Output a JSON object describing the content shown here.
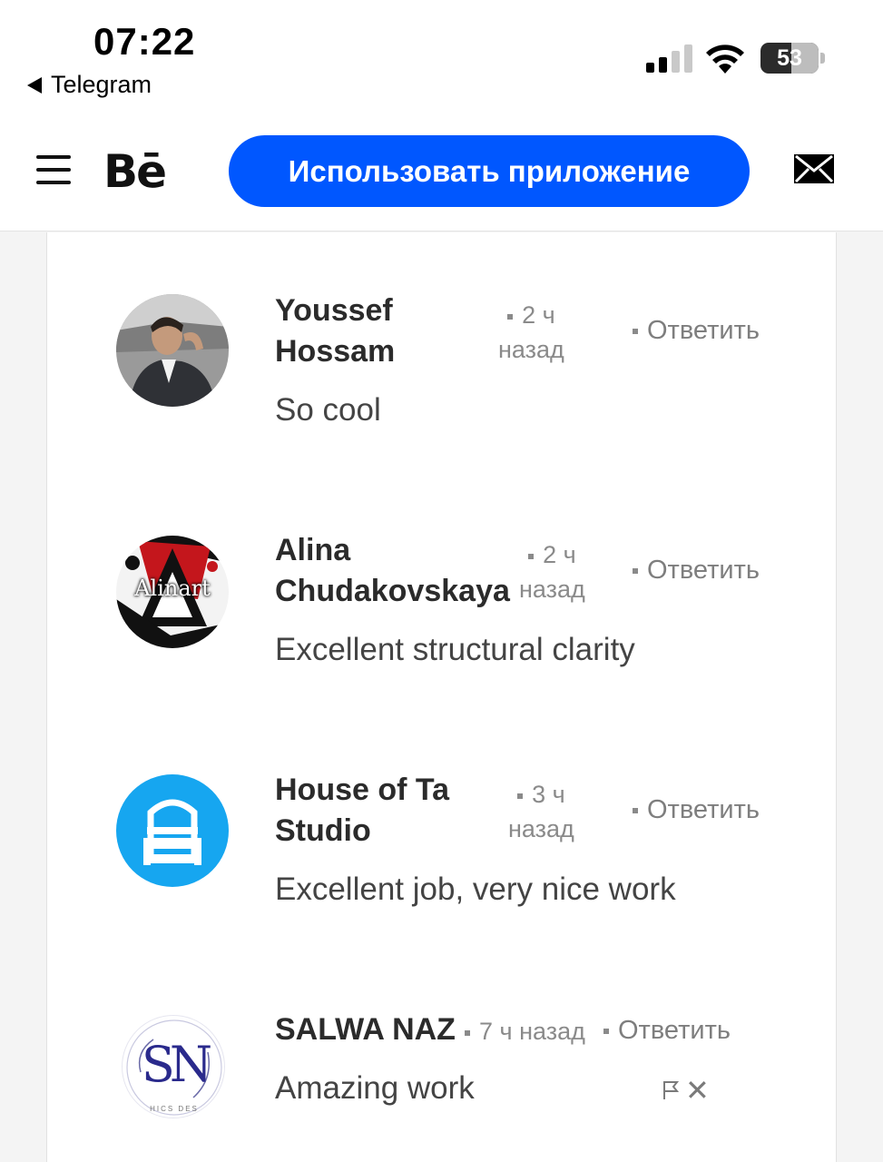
{
  "status_bar": {
    "time": "07:22",
    "back_label": "Telegram",
    "battery_level": "53"
  },
  "header": {
    "logo": "Bē",
    "open_app_label": "Использовать приложение"
  },
  "comments": [
    {
      "author_line1": "Youssef",
      "author_line2": "Hossam",
      "time_line1": "2 ч",
      "time_line2": "назад",
      "reply": "Ответить",
      "text": "So cool"
    },
    {
      "author_line1": "Alina",
      "author_line2": "Chudakovskaya",
      "time_line1": "2 ч",
      "time_line2": "назад",
      "reply": "Ответить",
      "text": "Excellent structural clarity",
      "avatar_text": "Alinart"
    },
    {
      "author_line1": "House of Ta",
      "author_line2": "Studio",
      "time_line1": "3 ч",
      "time_line2": "назад",
      "reply": "Ответить",
      "text": "Excellent job, very nice work"
    },
    {
      "author": "SALWA NAZ",
      "time": "7 ч назад",
      "reply": "Ответить",
      "text": "Amazing work",
      "avatar_text": "SN",
      "avatar_subtext": "HICS DES"
    }
  ],
  "icons": {
    "hamburger": "menu-icon",
    "mail": "mail-icon",
    "flag": "flag-icon",
    "close": "close-icon"
  },
  "colors": {
    "accent": "#0057ff",
    "house_of_ta_avatar": "#16a6f0"
  }
}
